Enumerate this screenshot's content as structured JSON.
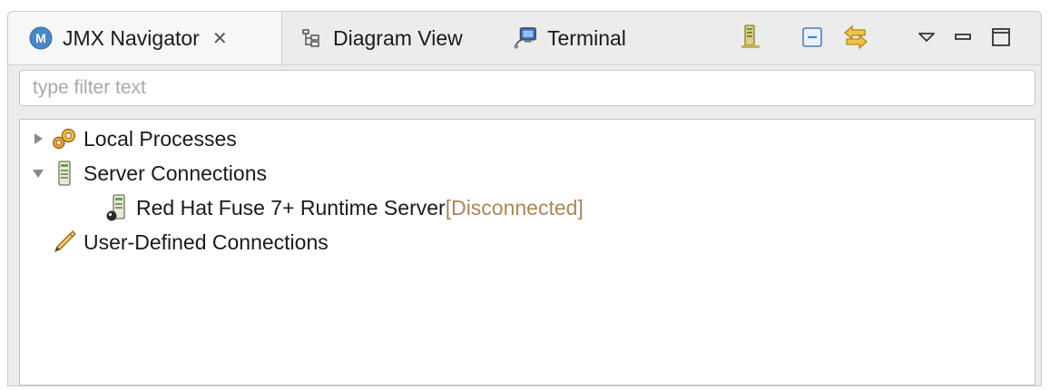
{
  "tabs": [
    {
      "label": "JMX Navigator",
      "icon": "jmx-navigator-icon",
      "active": true,
      "closable": true
    },
    {
      "label": "Diagram View",
      "icon": "diagram-view-icon",
      "active": false
    },
    {
      "label": "Terminal",
      "icon": "terminal-icon",
      "active": false
    }
  ],
  "toolbar": {
    "icons": [
      "new-connection-icon",
      "collapse-all-icon",
      "link-with-editor-icon",
      "view-menu-icon",
      "minimize-icon",
      "maximize-icon"
    ]
  },
  "filter": {
    "placeholder": "type filter text",
    "value": ""
  },
  "tree": {
    "nodes": [
      {
        "label": "Local Processes",
        "expanded": false,
        "icon": "local-processes-icon"
      },
      {
        "label": "Server Connections",
        "expanded": true,
        "icon": "server-icon",
        "children": [
          {
            "label": "Red Hat Fuse 7+ Runtime Server",
            "status": "[Disconnected]",
            "icon": "server-disconnected-icon"
          }
        ]
      },
      {
        "label": "User-Defined Connections",
        "icon": "pencil-icon"
      }
    ]
  },
  "colors": {
    "status_text": "#a8875a",
    "tab_bar_bg": "#ececec",
    "active_tab_bg": "#f7f7f7"
  }
}
